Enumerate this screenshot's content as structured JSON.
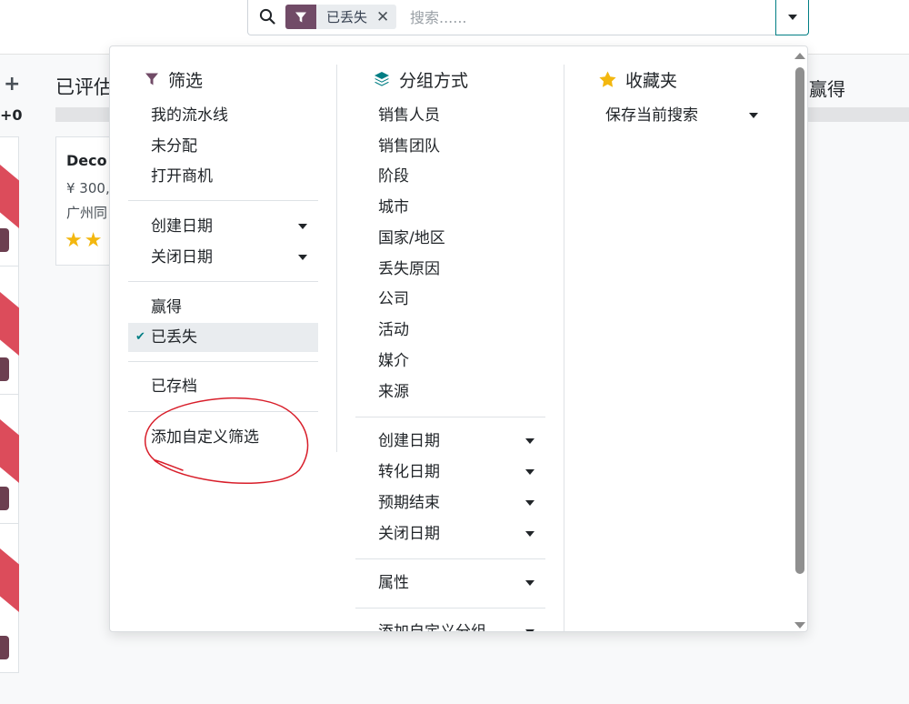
{
  "search": {
    "facet_value": "已丢失",
    "placeholder": "搜索......"
  },
  "kanban": {
    "add_symbol": "+",
    "left_count": "+0",
    "column_title": "已评估",
    "right_column_title": "赢得",
    "card": {
      "title": "Deco",
      "amount": "¥ 300,",
      "company": "广州同",
      "stars": "★★"
    }
  },
  "filters": {
    "heading": "筛选",
    "group1": [
      "我的流水线",
      "未分配",
      "打开商机"
    ],
    "group2": [
      "创建日期",
      "关闭日期"
    ],
    "group3": [
      "赢得",
      "已丢失"
    ],
    "group3_active_index": 1,
    "group4": [
      "已存档"
    ],
    "add_custom": "添加自定义筛选"
  },
  "groupby": {
    "heading": "分组方式",
    "group1": [
      "销售人员",
      "销售团队",
      "阶段",
      "城市",
      "国家/地区",
      "丢失原因",
      "公司",
      "活动",
      "媒介",
      "来源"
    ],
    "group2": [
      "创建日期",
      "转化日期",
      "预期结束",
      "关闭日期"
    ],
    "group3": [
      "属性"
    ],
    "add_custom": "添加自定义分组"
  },
  "favorites": {
    "heading": "收藏夹",
    "save_current": "保存当前搜索"
  },
  "colors": {
    "brand": "#714b67",
    "accent": "#017e84",
    "annotation": "#d81e2a",
    "star": "#f3b70f",
    "ribbon": "#dc4c5b"
  }
}
